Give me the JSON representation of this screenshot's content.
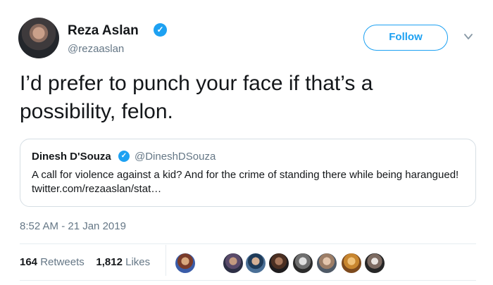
{
  "author": {
    "name": "Reza Aslan",
    "handle": "@rezaaslan",
    "verified": true
  },
  "follow_label": "Follow",
  "tweet_text": "I’d prefer to punch your face if that’s a possibility, felon.",
  "quoted_tweet": {
    "name": "Dinesh D'Souza",
    "handle": "@DineshDSouza",
    "verified": true,
    "text": "A call for violence against a kid? And for the crime of standing there while being harangued! twitter.com/rezaaslan/stat…"
  },
  "timestamp": "8:52 AM - 21 Jan 2019",
  "stats": {
    "retweets_count": "164",
    "retweets_label": "Retweets",
    "likes_count": "1,812",
    "likes_label": "Likes"
  },
  "colors": {
    "accent": "#1da1f2",
    "secondary_text": "#657786",
    "border": "#e6ecf0"
  },
  "icons": {
    "verified": "verified-badge-icon",
    "more": "chevron-down-icon"
  }
}
